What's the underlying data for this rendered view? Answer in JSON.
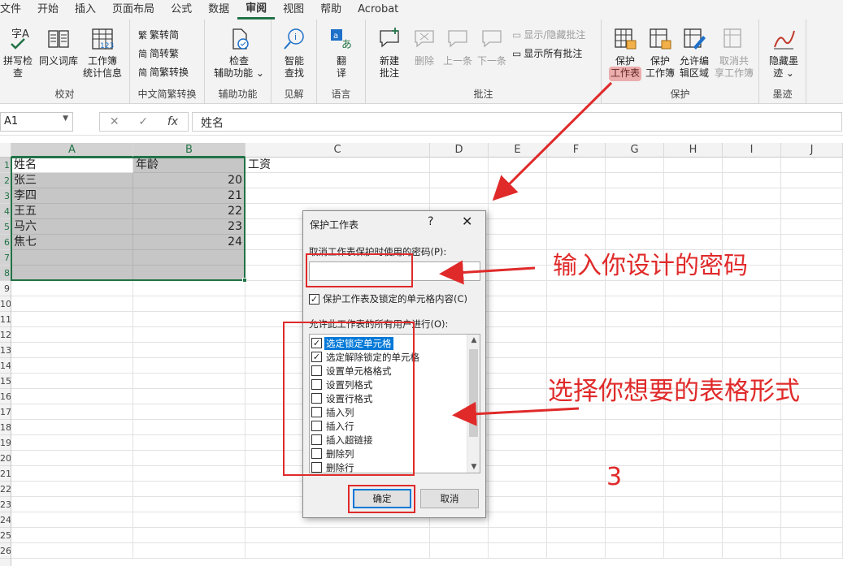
{
  "menu": {
    "tabs": [
      "文件",
      "开始",
      "插入",
      "页面布局",
      "公式",
      "数据",
      "审阅",
      "视图",
      "帮助",
      "Acrobat"
    ],
    "active_tab": "审阅"
  },
  "ribbon": {
    "proofing": {
      "label": "校对",
      "spell_check": "拼写检查",
      "thesaurus": "同义词库",
      "workbook_stats": [
        "工作簿",
        "统计信息"
      ]
    },
    "chinese": {
      "label": "中文简繁转换",
      "to_simplified": "繁转简",
      "to_traditional": "简转繁",
      "convert": "简繁转换"
    },
    "accessibility": {
      "label": "辅助功能",
      "check": [
        "检查",
        "辅助功能 ⌄"
      ]
    },
    "insights": {
      "label": "见解",
      "smart_lookup": [
        "智能",
        "查找"
      ]
    },
    "language": {
      "label": "语言",
      "translate": [
        "翻",
        "译"
      ]
    },
    "comments": {
      "label": "批注",
      "new": [
        "新建",
        "批注"
      ],
      "delete": "删除",
      "prev": "上一条",
      "next": "下一条",
      "show_hide": "显示/隐藏批注",
      "show_all": "显示所有批注"
    },
    "protect": {
      "label": "保护",
      "sheet": [
        "保护",
        "工作表"
      ],
      "workbook": [
        "保护",
        "工作簿"
      ],
      "allow_edit": [
        "允许编",
        "辑区域"
      ],
      "unshare": [
        "取消共",
        "享工作簿"
      ]
    },
    "ink": {
      "label": "墨迹",
      "hide": [
        "隐藏墨",
        "迹 ⌄"
      ]
    }
  },
  "formula_bar": {
    "cell_ref": "A1",
    "content": "姓名"
  },
  "columns": [
    "A",
    "B",
    "C",
    "D",
    "E",
    "F",
    "G",
    "H",
    "I",
    "J"
  ],
  "rows": [
    "1",
    "2",
    "3",
    "4",
    "5",
    "6",
    "7",
    "8",
    "9",
    "10",
    "11",
    "12",
    "13",
    "14",
    "15",
    "16",
    "17",
    "18",
    "19",
    "20",
    "21",
    "22",
    "23",
    "24",
    "25",
    "26"
  ],
  "sheet": {
    "headers": [
      "姓名",
      "年龄",
      "工资"
    ],
    "data": [
      [
        "张三",
        "20"
      ],
      [
        "李四",
        "21"
      ],
      [
        "王五",
        "22"
      ],
      [
        "马六",
        "23"
      ],
      [
        "焦七",
        "24"
      ]
    ]
  },
  "dialog": {
    "title": "保护工作表",
    "help": "?",
    "close": "✕",
    "password_label": "取消工作表保护时使用的密码(P):",
    "protect_label": "保护工作表及锁定的单元格内容(C)",
    "allow_label": "允许此工作表的所有用户进行(O):",
    "options": [
      {
        "label": "选定锁定单元格",
        "checked": true
      },
      {
        "label": "选定解除锁定的单元格",
        "checked": true
      },
      {
        "label": "设置单元格格式",
        "checked": false
      },
      {
        "label": "设置列格式",
        "checked": false
      },
      {
        "label": "设置行格式",
        "checked": false
      },
      {
        "label": "插入列",
        "checked": false
      },
      {
        "label": "插入行",
        "checked": false
      },
      {
        "label": "插入超链接",
        "checked": false
      },
      {
        "label": "删除列",
        "checked": false
      },
      {
        "label": "删除行",
        "checked": false
      }
    ],
    "ok": "确定",
    "cancel": "取消"
  },
  "annotations": {
    "password": "输入你设计的密码",
    "options": "选择你想要的表格形式",
    "step": "3",
    "color": "#e02a2a"
  }
}
